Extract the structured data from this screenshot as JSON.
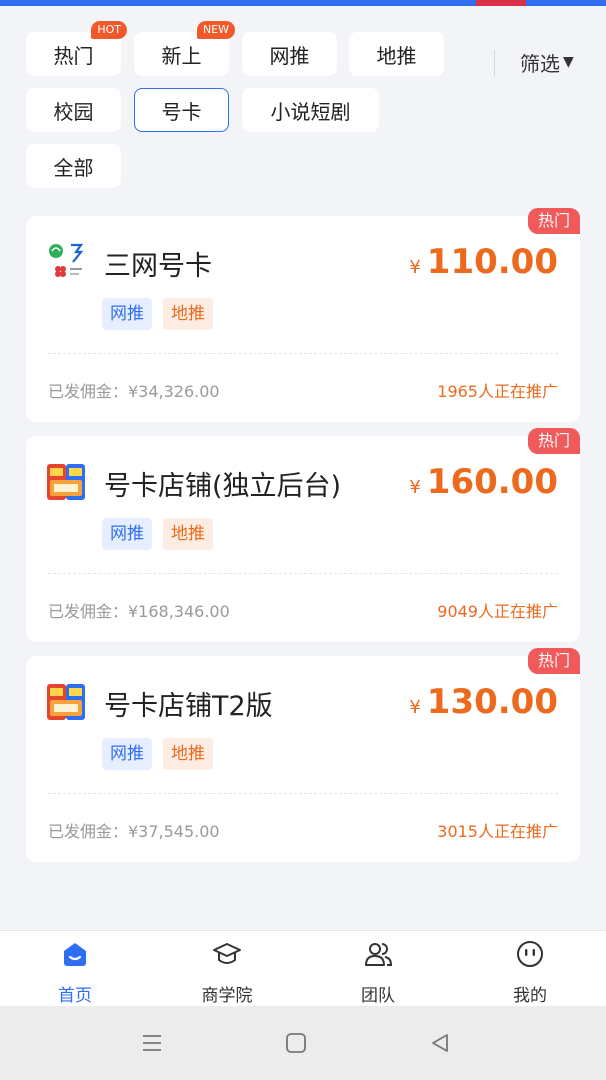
{
  "filters": {
    "chips": [
      {
        "label": "热门",
        "badge": "HOT"
      },
      {
        "label": "新上",
        "badge": "NEW"
      },
      {
        "label": "网推",
        "badge": ""
      },
      {
        "label": "地推",
        "badge": ""
      },
      {
        "label": "校园",
        "badge": ""
      },
      {
        "label": "号卡",
        "badge": "",
        "selected": true
      },
      {
        "label": "小说短剧",
        "badge": ""
      },
      {
        "label": "全部",
        "badge": ""
      }
    ],
    "filter_label": "筛选"
  },
  "products": [
    {
      "hot_badge": "热门",
      "title": "三网号卡",
      "currency": "¥",
      "price": "110.00",
      "tags": [
        "网推",
        "地推"
      ],
      "paid_commission": "已发佣金：¥34,326.00",
      "promoting": "1965人正在推广",
      "logo": "carrier-logos-icon"
    },
    {
      "hot_badge": "热门",
      "title": "号卡店铺(独立后台)",
      "currency": "¥",
      "price": "160.00",
      "tags": [
        "网推",
        "地推"
      ],
      "paid_commission": "已发佣金：¥168,346.00",
      "promoting": "9049人正在推广",
      "logo": "sim-cards-icon"
    },
    {
      "hot_badge": "热门",
      "title": "号卡店铺T2版",
      "currency": "¥",
      "price": "130.00",
      "tags": [
        "网推",
        "地推"
      ],
      "paid_commission": "已发佣金：¥37,545.00",
      "promoting": "3015人正在推广",
      "logo": "sim-cards-icon"
    }
  ],
  "tabbar": [
    {
      "label": "首页",
      "icon": "home-icon",
      "active": true
    },
    {
      "label": "商学院",
      "icon": "graduation-cap-icon",
      "active": false
    },
    {
      "label": "团队",
      "icon": "team-icon",
      "active": false
    },
    {
      "label": "我的",
      "icon": "profile-face-icon",
      "active": false
    }
  ],
  "colors": {
    "accent": "#2f6df3",
    "price": "#ec6a1e",
    "hot_badge": "#f05a5a",
    "background": "#f2f4f8"
  }
}
